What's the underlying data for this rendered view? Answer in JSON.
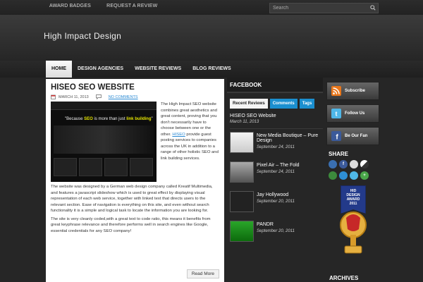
{
  "topnav": {
    "items": [
      "AWARD BADGES",
      "REQUEST A REVIEW"
    ]
  },
  "search": {
    "placeholder": "Search"
  },
  "header": {
    "logo": "High Impact Design"
  },
  "mainnav": {
    "items": [
      "HOME",
      "DESIGN AGENCIES",
      "WEBSITE REVIEWS",
      "BLOG REVIEWS"
    ]
  },
  "post": {
    "title": "HISEO SEO WEBSITE",
    "date": "MARCH 11, 2013",
    "comments": "NO COMMENTS",
    "thumb_tagline_pre": "\"Because ",
    "thumb_tagline_seo": "SEO",
    "thumb_tagline_mid": " is more than just ",
    "thumb_tagline_link": "link building",
    "thumb_tagline_end": "\"",
    "intro_before_link": "The High Impact SEO website combines great aesthetics and great content, proving that you don't necessarily have to choose between one or the other. ",
    "intro_link": "HISEO",
    "intro_after_link": " provide guest posting services to companies across the UK in addition to a range of other holistic SEO and link building services.",
    "para2": "The website was designed by a German web design company called Kreatif Multimedia, and features a javascript slideshow which is used to great effect by displaying visual representation of each web service, together with linked text that directs users to the relevant section. Ease of navigation is everything on this site, and even without search functionality it is a simple and logical task to locate the information you are looking for.",
    "para3": "The site is very cleanly coded,with a great text to code ratio, this means it benefits from great keyphrase relevance and therefore performs well in search engines like Google, essential credentials for any SEO company!",
    "read_more": "Read More"
  },
  "facebook": {
    "heading": "FACEBOOK",
    "tabs": [
      "Recent Reviews",
      "Comments",
      "Tags"
    ],
    "featured": {
      "title": "HISEO SEO Website",
      "date": "March 11, 2013"
    },
    "items": [
      {
        "title": "New Media Boutique – Pure Design",
        "date": "September 24, 2011"
      },
      {
        "title": "Pixel Air – The Fold",
        "date": "September 24, 2011"
      },
      {
        "title": "Jay Hollywood",
        "date": "September 20, 2011"
      },
      {
        "title": "PANDR",
        "date": "September 20, 2011"
      }
    ]
  },
  "social": {
    "buttons": [
      "Subscribe",
      "Follow Us",
      "Be Our Fan"
    ],
    "share_heading": "SHARE",
    "badge": [
      "HID",
      "DESIGN",
      "AWARD",
      "2011"
    ],
    "archives": "ARCHIVES"
  },
  "colors": {
    "accent": "#1b8fcf",
    "link": "#2a8ad4",
    "rss": "#e9761a"
  }
}
